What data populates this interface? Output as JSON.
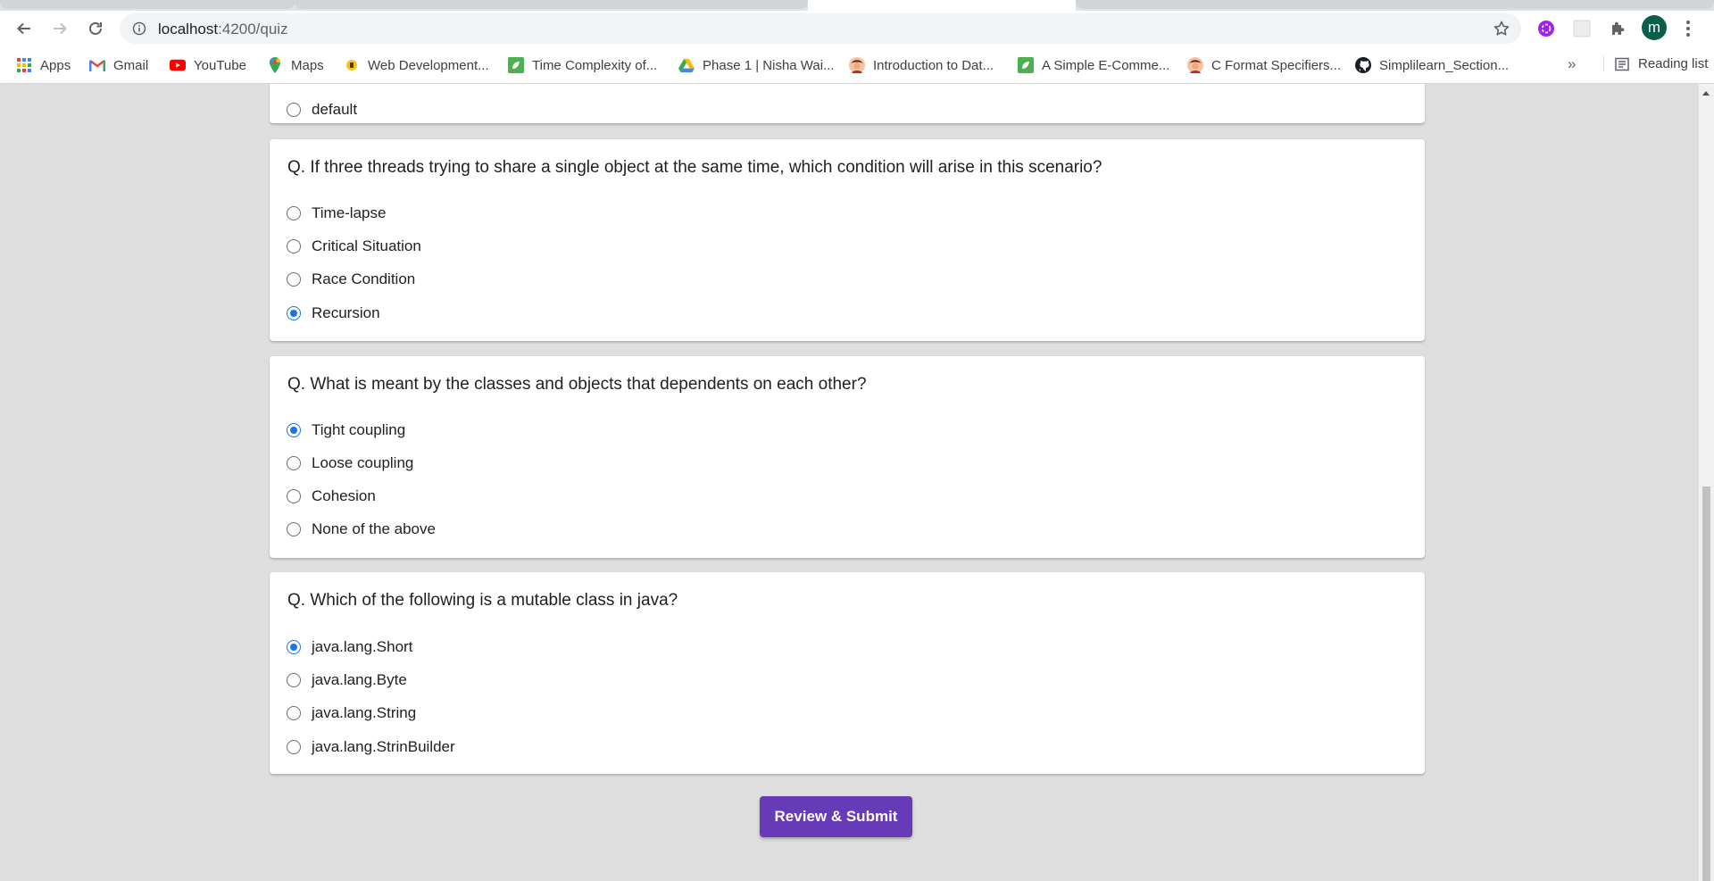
{
  "browser": {
    "url_host": "localhost",
    "url_path": ":4200/quiz",
    "profile_initial": "m",
    "bookmarks": [
      {
        "label": "Apps",
        "icon": "apps-grid-icon"
      },
      {
        "label": "Gmail",
        "icon": "gmail-icon"
      },
      {
        "label": "YouTube",
        "icon": "youtube-icon"
      },
      {
        "label": "Maps",
        "icon": "maps-icon"
      },
      {
        "label": "Web Development...",
        "icon": "bookmark-site-icon"
      },
      {
        "label": "Time Complexity of...",
        "icon": "leaf-icon"
      },
      {
        "label": "Phase 1 | Nisha Wai...",
        "icon": "google-drive-icon"
      },
      {
        "label": "Introduction to Dat...",
        "icon": "avatar-favicon-icon"
      },
      {
        "label": "A Simple E-Comme...",
        "icon": "leaf-icon"
      },
      {
        "label": "C Format Specifiers...",
        "icon": "avatar-favicon-icon"
      },
      {
        "label": "Simplilearn_Section...",
        "icon": "github-icon"
      }
    ],
    "more_bookmarks": "»",
    "reading_list": "Reading list"
  },
  "quiz": {
    "partial_option": {
      "label": "default",
      "selected": false
    },
    "questions": [
      {
        "text": "Q. If three threads trying to share a single object at the same time, which condition will arise in this scenario?",
        "options": [
          {
            "label": "Time-lapse",
            "selected": false
          },
          {
            "label": "Critical Situation",
            "selected": false
          },
          {
            "label": "Race Condition",
            "selected": false
          },
          {
            "label": "Recursion",
            "selected": true
          }
        ]
      },
      {
        "text": "Q. What is meant by the classes and objects that dependents on each other?",
        "options": [
          {
            "label": "Tight coupling",
            "selected": true
          },
          {
            "label": "Loose coupling",
            "selected": false
          },
          {
            "label": "Cohesion",
            "selected": false
          },
          {
            "label": "None of the above",
            "selected": false
          }
        ]
      },
      {
        "text": "Q. Which of the following is a mutable class in java?",
        "options": [
          {
            "label": "java.lang.Short",
            "selected": true
          },
          {
            "label": "java.lang.Byte",
            "selected": false
          },
          {
            "label": "java.lang.String",
            "selected": false
          },
          {
            "label": "java.lang.StrinBuilder",
            "selected": false
          }
        ]
      }
    ],
    "submit_label": "Review & Submit"
  },
  "colors": {
    "accent_purple": "#673ab7",
    "radio_selected": "#1a73e8",
    "page_background": "#dedede"
  }
}
